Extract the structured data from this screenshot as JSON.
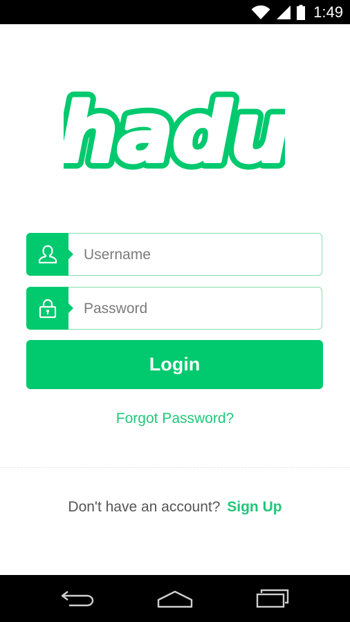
{
  "status_bar": {
    "time": "1:49",
    "icons": [
      "wifi-icon",
      "cell-signal-icon",
      "battery-icon"
    ]
  },
  "logo": {
    "text": "hadu",
    "color": "#00c96e"
  },
  "login_form": {
    "username": {
      "placeholder": "Username",
      "value": "",
      "icon": "user-icon"
    },
    "password": {
      "placeholder": "Password",
      "value": "",
      "icon": "lock-icon"
    },
    "login_label": "Login",
    "forgot_label": "Forgot Password?"
  },
  "signup": {
    "prompt": "Don't have an account?",
    "link_label": "Sign Up"
  },
  "nav_bar": {
    "buttons": [
      "back-icon",
      "home-icon",
      "recents-icon"
    ]
  },
  "colors": {
    "accent": "#00c96e",
    "field_border": "#7fe0ad",
    "text_muted": "#555555"
  }
}
